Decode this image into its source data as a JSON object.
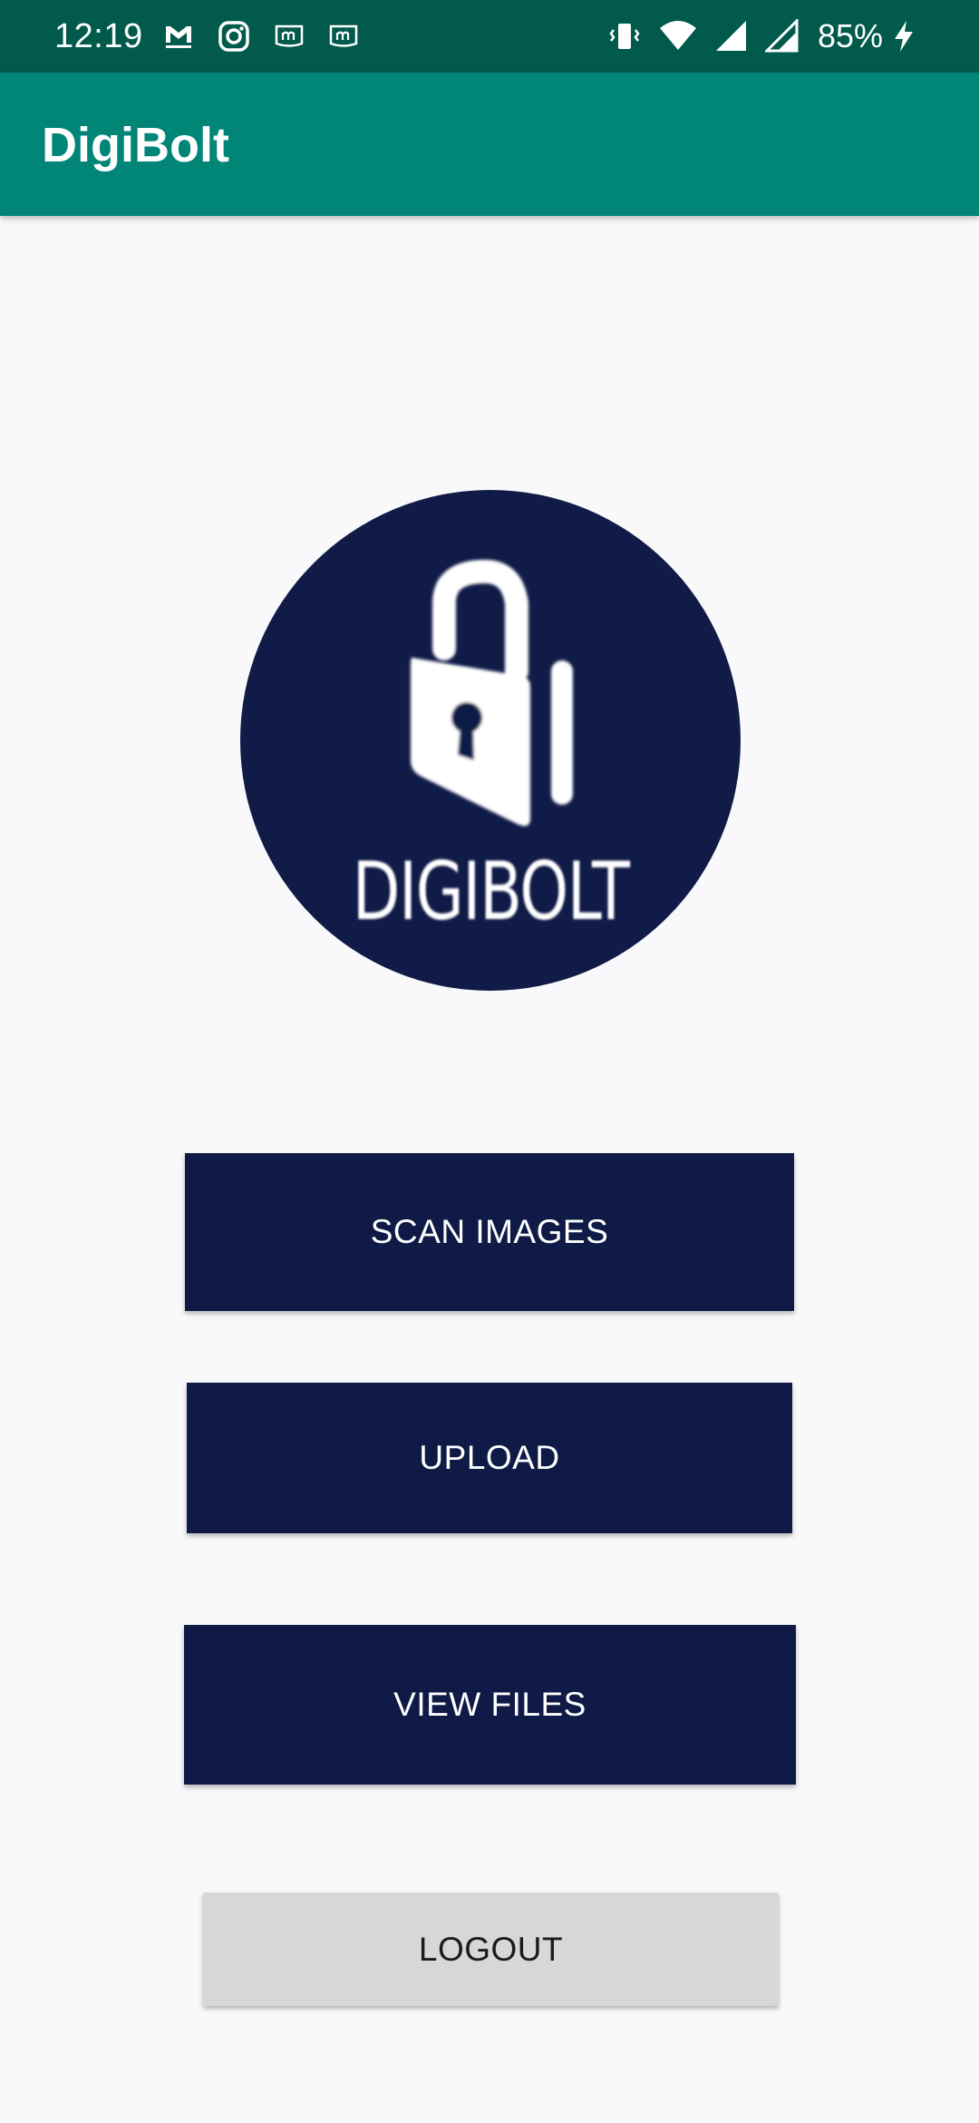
{
  "status_bar": {
    "time": "12:19",
    "left_icons": [
      "gmail-icon",
      "instagram-icon",
      "app-m-icon",
      "app-m-icon"
    ],
    "right_icons": [
      "vibrate-icon",
      "wifi-icon",
      "signal-icon",
      "signal-icon"
    ],
    "battery": "85%",
    "charging_icon": "bolt-icon",
    "background": "#015a4c"
  },
  "app_bar": {
    "title": "DigiBolt",
    "background": "#008577"
  },
  "logo": {
    "text": "DIGIBOLT",
    "background": "#101b47"
  },
  "buttons": {
    "scan": "SCAN IMAGES",
    "upload": "UPLOAD",
    "view": "VIEW FILES",
    "logout": "LOGOUT"
  },
  "colors": {
    "primary_button": "#0f1b46",
    "secondary_button": "#d6d7d7",
    "page_background": "#f9f9fb"
  }
}
